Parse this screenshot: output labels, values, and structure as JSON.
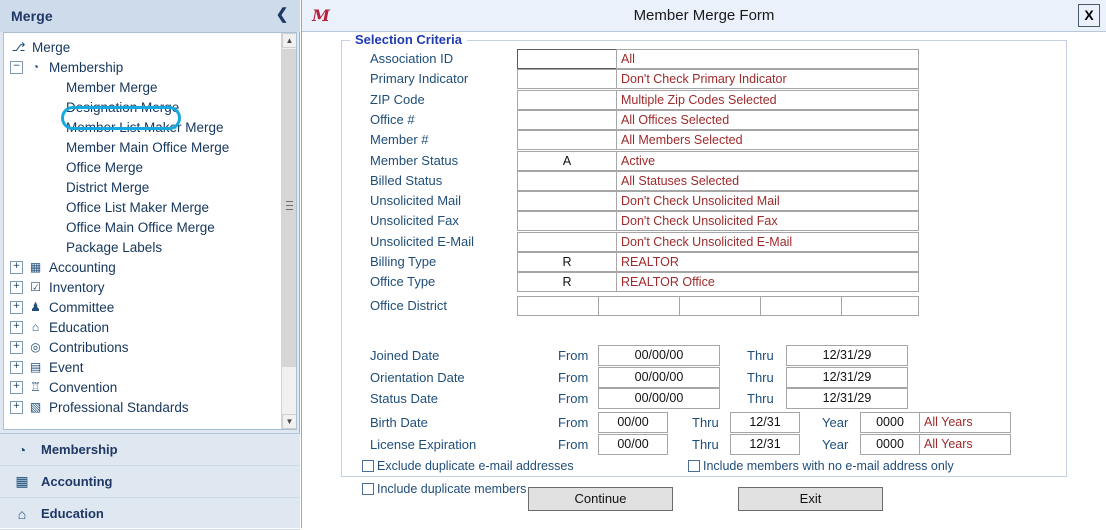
{
  "nav": {
    "title": "Merge",
    "collapse_icon": "chevron-left-icon",
    "tree": [
      {
        "label": "Merge",
        "level": 0,
        "icon": "merge-icon",
        "expander": "",
        "selected": false
      },
      {
        "label": "Membership",
        "level": 1,
        "icon": "member-icon",
        "expander": "−",
        "selected": false
      },
      {
        "label": "Member Merge",
        "level": 2,
        "icon": "",
        "expander": "",
        "selected": true
      },
      {
        "label": "Designation Merge",
        "level": 2,
        "icon": "",
        "expander": "",
        "selected": false
      },
      {
        "label": "Member List Maker Merge",
        "level": 2,
        "icon": "",
        "expander": "",
        "selected": false
      },
      {
        "label": "Member Main Office Merge",
        "level": 2,
        "icon": "",
        "expander": "",
        "selected": false
      },
      {
        "label": "Office Merge",
        "level": 2,
        "icon": "",
        "expander": "",
        "selected": false
      },
      {
        "label": "District Merge",
        "level": 2,
        "icon": "",
        "expander": "",
        "selected": false
      },
      {
        "label": "Office List Maker Merge",
        "level": 2,
        "icon": "",
        "expander": "",
        "selected": false
      },
      {
        "label": "Office Main Office Merge",
        "level": 2,
        "icon": "",
        "expander": "",
        "selected": false
      },
      {
        "label": "Package Labels",
        "level": 2,
        "icon": "",
        "expander": "",
        "selected": false
      },
      {
        "label": "Accounting",
        "level": 1,
        "icon": "calculator-icon",
        "expander": "+",
        "selected": false
      },
      {
        "label": "Inventory",
        "level": 1,
        "icon": "clipboard-check-icon",
        "expander": "+",
        "selected": false
      },
      {
        "label": "Committee",
        "level": 1,
        "icon": "people-group-icon",
        "expander": "+",
        "selected": false
      },
      {
        "label": "Education",
        "level": 1,
        "icon": "graduation-cap-icon",
        "expander": "+",
        "selected": false
      },
      {
        "label": "Contributions",
        "level": 1,
        "icon": "coins-icon",
        "expander": "+",
        "selected": false
      },
      {
        "label": "Event",
        "level": 1,
        "icon": "calendar-icon",
        "expander": "+",
        "selected": false
      },
      {
        "label": "Convention",
        "level": 1,
        "icon": "podium-icon",
        "expander": "+",
        "selected": false
      },
      {
        "label": "Professional Standards",
        "level": 1,
        "icon": "certificate-icon",
        "expander": "+",
        "selected": false
      }
    ],
    "modules": [
      {
        "label": "Membership",
        "icon": "member-icon"
      },
      {
        "label": "Accounting",
        "icon": "calculator-icon"
      },
      {
        "label": "Education",
        "icon": "graduation-cap-icon"
      }
    ],
    "scrollbar": {
      "up": "▲",
      "down": "▼"
    }
  },
  "window": {
    "title": "Member Merge Form",
    "app_icon": "mm-logo-icon",
    "close_label": "X"
  },
  "form": {
    "legend": "Selection Criteria",
    "criteria": [
      {
        "label": "Association ID",
        "code": "",
        "desc": "All",
        "focused": true
      },
      {
        "label": "Primary Indicator",
        "code": "",
        "desc": "Don't Check Primary Indicator",
        "focused": false
      },
      {
        "label": "ZIP Code",
        "code": "",
        "desc": "Multiple Zip Codes Selected",
        "focused": false
      },
      {
        "label": "Office #",
        "code": "",
        "desc": "All Offices Selected",
        "focused": false
      },
      {
        "label": "Member #",
        "code": "",
        "desc": "All Members Selected",
        "focused": false
      },
      {
        "label": "Member Status",
        "code": "A",
        "desc": "Active",
        "focused": false
      },
      {
        "label": "Billed Status",
        "code": "",
        "desc": "All Statuses Selected",
        "focused": false
      },
      {
        "label": "Unsolicited Mail",
        "code": "",
        "desc": "Don't Check Unsolicited Mail",
        "focused": false
      },
      {
        "label": "Unsolicited Fax",
        "code": "",
        "desc": "Don't Check Unsolicited Fax",
        "focused": false
      },
      {
        "label": "Unsolicited E-Mail",
        "code": "",
        "desc": "Don't Check Unsolicited E-Mail",
        "focused": false
      },
      {
        "label": "Billing Type",
        "code": "R",
        "desc": "REALTOR",
        "focused": false
      },
      {
        "label": "Office Type",
        "code": "R",
        "desc": "REALTOR Office",
        "focused": false
      }
    ],
    "office_district": {
      "label": "Office District",
      "cells": [
        "",
        "",
        "",
        "",
        ""
      ]
    },
    "date_ranges": [
      {
        "label": "Joined Date",
        "from_label": "From",
        "from": "00/00/00",
        "thru_label": "Thru",
        "thru": "12/31/29"
      },
      {
        "label": "Orientation Date",
        "from_label": "From",
        "from": "00/00/00",
        "thru_label": "Thru",
        "thru": "12/31/29"
      },
      {
        "label": "Status Date",
        "from_label": "From",
        "from": "00/00/00",
        "thru_label": "Thru",
        "thru": "12/31/29"
      }
    ],
    "year_ranges": [
      {
        "label": "Birth Date",
        "from_label": "From",
        "from": "00/00",
        "thru_label": "Thru",
        "thru": "12/31",
        "year_label": "Year",
        "year": "0000",
        "year_desc": "All Years"
      },
      {
        "label": "License Expiration",
        "from_label": "From",
        "from": "00/00",
        "thru_label": "Thru",
        "thru": "12/31",
        "year_label": "Year",
        "year": "0000",
        "year_desc": "All Years"
      }
    ],
    "checkboxes": [
      {
        "label": "Exclude duplicate e-mail addresses",
        "checked": false
      },
      {
        "label": "Include members with no e-mail address only",
        "checked": false
      },
      {
        "label": "Include duplicate members",
        "checked": false
      }
    ],
    "buttons": {
      "continue": "Continue",
      "exit": "Exit"
    }
  },
  "colors": {
    "accent": "#16a9e1",
    "label_blue": "#1f4e79",
    "value_red": "#9e2a2b",
    "legend_blue": "#1f3bb3",
    "nav_bg": "#dfe7f1"
  }
}
